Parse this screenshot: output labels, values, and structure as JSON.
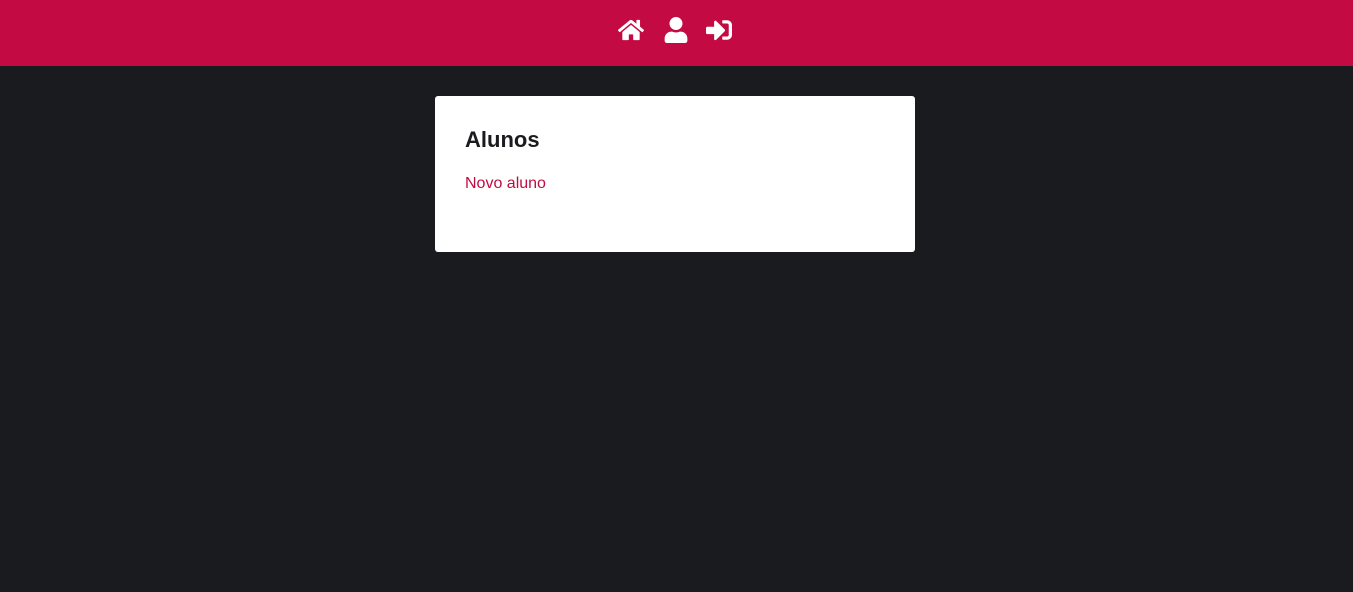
{
  "colors": {
    "primary": "#c40a43",
    "background": "#1a1b1f",
    "card": "#ffffff",
    "text": "#1b1b1f"
  },
  "nav": {
    "items": [
      {
        "icon": "home-icon"
      },
      {
        "icon": "user-icon"
      },
      {
        "icon": "sign-in-icon"
      }
    ]
  },
  "main": {
    "title": "Alunos",
    "new_student_label": "Novo aluno"
  }
}
